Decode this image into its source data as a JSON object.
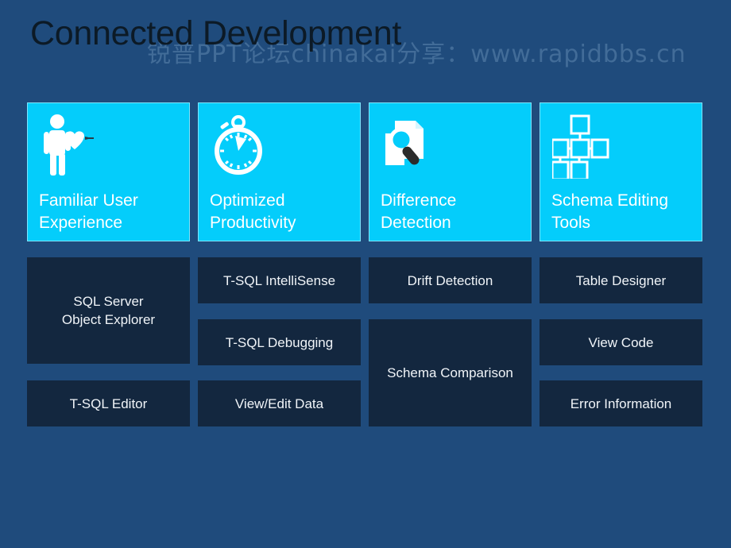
{
  "slide": {
    "title": "Connected Development",
    "watermark": "锐普PPT论坛chinakai分享：www.rapidbbs.cn",
    "colors": {
      "background": "#1f4b7c",
      "accent_cyan": "#04cdfb",
      "tile_dark": "#13273f",
      "title_text": "#0c1a26",
      "tile_text": "#f0f4f8"
    }
  },
  "features": [
    {
      "label": "Familiar User\nExperience",
      "icon": "person-with-heart-icon"
    },
    {
      "label": "Optimized\nProductivity",
      "icon": "stopwatch-icon"
    },
    {
      "label": "Difference\nDetection",
      "icon": "documents-magnifier-icon"
    },
    {
      "label": "Schema Editing\nTools",
      "icon": "schema-diagram-icon"
    }
  ],
  "items": {
    "column_1": [
      {
        "label": "SQL Server\nObject Explorer"
      },
      {
        "label": "T-SQL Editor"
      }
    ],
    "column_2": [
      {
        "label": "T-SQL IntelliSense"
      },
      {
        "label": "T-SQL Debugging"
      },
      {
        "label": "View/Edit Data"
      }
    ],
    "column_3": [
      {
        "label": "Drift Detection"
      },
      {
        "label": "Schema Comparison"
      }
    ],
    "column_4": [
      {
        "label": "Table Designer"
      },
      {
        "label": "View Code"
      },
      {
        "label": "Error Information"
      }
    ]
  }
}
